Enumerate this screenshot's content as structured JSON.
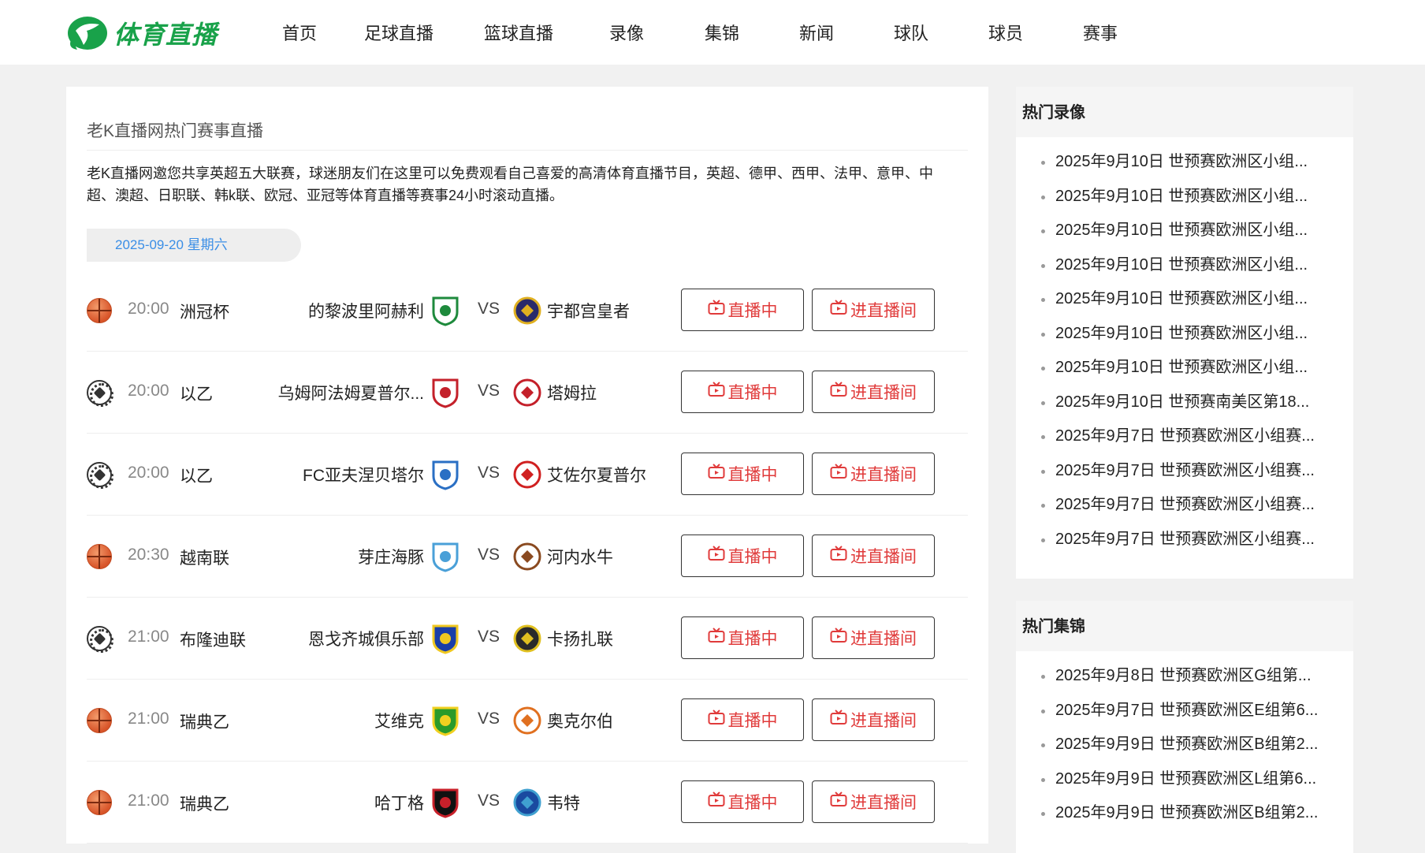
{
  "header": {
    "logo_text": "体育直播",
    "nav": [
      "首页",
      "足球直播",
      "篮球直播",
      "录像",
      "集锦",
      "新闻",
      "球队",
      "球员",
      "赛事"
    ]
  },
  "main": {
    "title": "老K直播网热门赛事直播",
    "description": "老K直播网邀您共享英超五大联赛，球迷朋友们在这里可以免费观看自己喜爱的高清体育直播节目，英超、德甲、西甲、法甲、意甲、中超、澳超、日职联、韩k联、欧冠、亚冠等体育直播等赛事24小时滚动直播。",
    "date": "2025-09-20 星期六",
    "vs_label": "VS",
    "live_label": "直播中",
    "room_label": "进直播间",
    "matches": [
      {
        "sport": "basketball",
        "time": "20:00",
        "league": "洲冠杯",
        "home": "的黎波里阿赫利",
        "away": "宇都宫皇者"
      },
      {
        "sport": "football",
        "time": "20:00",
        "league": "以乙",
        "home": "乌姆阿法姆夏普尔...",
        "away": "塔姆拉"
      },
      {
        "sport": "football",
        "time": "20:00",
        "league": "以乙",
        "home": "FC亚夫涅贝塔尔",
        "away": "艾佐尔夏普尔"
      },
      {
        "sport": "basketball",
        "time": "20:30",
        "league": "越南联",
        "home": "芽庄海豚",
        "away": "河内水牛"
      },
      {
        "sport": "football",
        "time": "21:00",
        "league": "布隆迪联",
        "home": "恩戈齐城俱乐部",
        "away": "卡扬扎联"
      },
      {
        "sport": "basketball",
        "time": "21:00",
        "league": "瑞典乙",
        "home": "艾维克",
        "away": "奥克尔伯"
      },
      {
        "sport": "basketball",
        "time": "21:00",
        "league": "瑞典乙",
        "home": "哈丁格",
        "away": "韦特"
      }
    ]
  },
  "sidebar": {
    "replay_title": "热门录像",
    "replays": [
      "2025年9月10日 世预赛欧洲区小组...",
      "2025年9月10日 世预赛欧洲区小组...",
      "2025年9月10日 世预赛欧洲区小组...",
      "2025年9月10日 世预赛欧洲区小组...",
      "2025年9月10日 世预赛欧洲区小组...",
      "2025年9月10日 世预赛欧洲区小组...",
      "2025年9月10日 世预赛欧洲区小组...",
      "2025年9月10日 世预赛南美区第18...",
      "2025年9月7日 世预赛欧洲区小组赛...",
      "2025年9月7日 世预赛欧洲区小组赛...",
      "2025年9月7日 世预赛欧洲区小组赛...",
      "2025年9月7日 世预赛欧洲区小组赛..."
    ],
    "highlight_title": "热门集锦",
    "highlights": [
      "2025年9月8日 世预赛欧洲区G组第...",
      "2025年9月7日 世预赛欧洲区E组第6...",
      "2025年9月9日 世预赛欧洲区B组第2...",
      "2025年9月9日 世预赛欧洲区L组第6...",
      "2025年9月9日 世预赛欧洲区B组第2..."
    ]
  }
}
